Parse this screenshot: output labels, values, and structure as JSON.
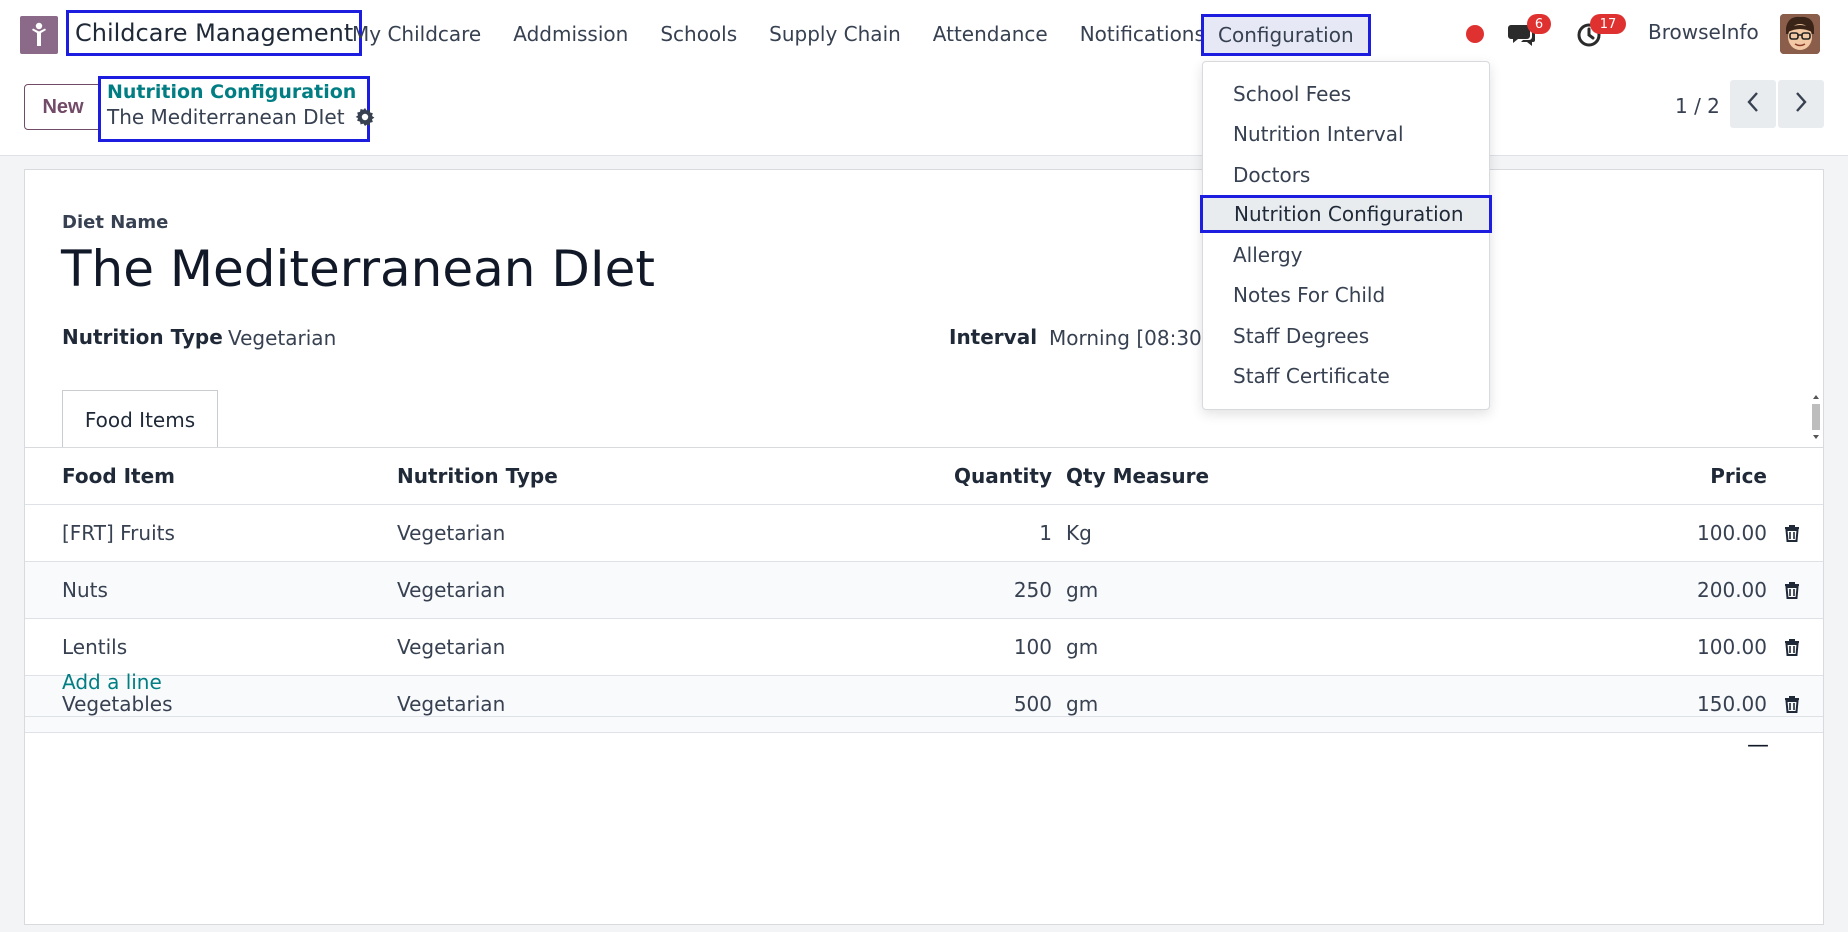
{
  "navbar": {
    "brand": "Childcare Management",
    "menu": [
      "My Childcare",
      "Addmission",
      "Schools",
      "Supply Chain",
      "Attendance",
      "Notifications"
    ],
    "active_menu": "Configuration",
    "messages_count": "6",
    "activities_count": "17",
    "company": "BrowseInfo"
  },
  "control": {
    "new_label": "New",
    "breadcrumb_parent": "Nutrition Configuration",
    "breadcrumb_current": "The Mediterranean DIet",
    "pager": "1 / 2"
  },
  "form": {
    "diet_name_label": "Diet Name",
    "diet_name": "The Mediterranean DIet",
    "nutrition_type_label": "Nutrition Type",
    "nutrition_type": "Vegetarian",
    "interval_label": "Interval",
    "interval": "Morning [08:30]"
  },
  "tabs": [
    "Food Items"
  ],
  "table": {
    "headers": {
      "food_item": "Food Item",
      "nutrition_type": "Nutrition Type",
      "quantity": "Quantity",
      "qty_measure": "Qty Measure",
      "price": "Price"
    },
    "rows": [
      {
        "food_item": "[FRT] Fruits",
        "nutrition_type": "Vegetarian",
        "quantity": "1",
        "qty_measure": "Kg",
        "price": "100.00"
      },
      {
        "food_item": "Nuts",
        "nutrition_type": "Vegetarian",
        "quantity": "250",
        "qty_measure": "gm",
        "price": "200.00"
      },
      {
        "food_item": "Lentils",
        "nutrition_type": "Vegetarian",
        "quantity": "100",
        "qty_measure": "gm",
        "price": "100.00"
      },
      {
        "food_item": "Vegetables",
        "nutrition_type": "Vegetarian",
        "quantity": "500",
        "qty_measure": "gm",
        "price": "150.00"
      }
    ],
    "add_line": "Add a line",
    "footer_mark": "—"
  },
  "dropdown": {
    "items": [
      "School Fees",
      "Nutrition Interval",
      "Doctors",
      "Nutrition Configuration",
      "Allergy",
      "Notes For Child",
      "Staff Degrees",
      "Staff Certificate"
    ],
    "active_item": "Nutrition Configuration"
  },
  "colors": {
    "brand_purple": "#714b67",
    "link_teal": "#017e84",
    "highlight_blue": "#1d1de0",
    "badge_red": "#e03131"
  },
  "icons": [
    "app-logo-icon",
    "chat-icon",
    "activity-clock-icon",
    "gear-icon",
    "chevron-left-icon",
    "chevron-right-icon",
    "trash-icon"
  ]
}
